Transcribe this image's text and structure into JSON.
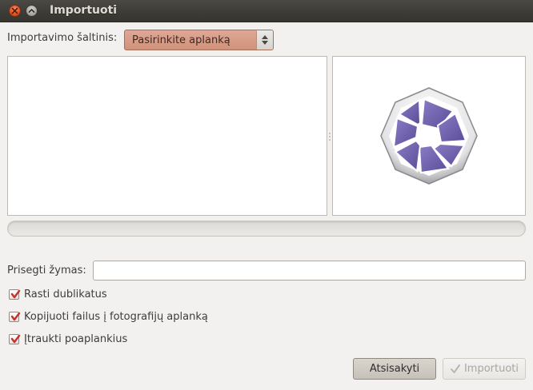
{
  "window": {
    "title": "Importuoti",
    "close_icon": "close-icon",
    "minimize_icon": "minimize-icon"
  },
  "source": {
    "label": "Importavimo šaltinis:",
    "selected": "Pasirinkite aplanką",
    "accent_color": "#d7997f"
  },
  "preview": {
    "logo": "f-spot-aperture-logo",
    "logo_colors": [
      "#6e5fa9",
      "#ffffff",
      "#9a9a9a"
    ]
  },
  "progress": {
    "value": 0
  },
  "tags": {
    "label": "Prisegti žymas:",
    "value": ""
  },
  "options": [
    {
      "label": "Rasti dublikatus",
      "checked": true
    },
    {
      "label": "Kopijuoti failus į fotografijų aplanką",
      "checked": true
    },
    {
      "label": "Įtraukti poaplankius",
      "checked": true
    }
  ],
  "buttons": {
    "cancel": "Atsisakyti",
    "import": "Importuoti",
    "import_enabled": false
  },
  "check_color": "#c8302a"
}
